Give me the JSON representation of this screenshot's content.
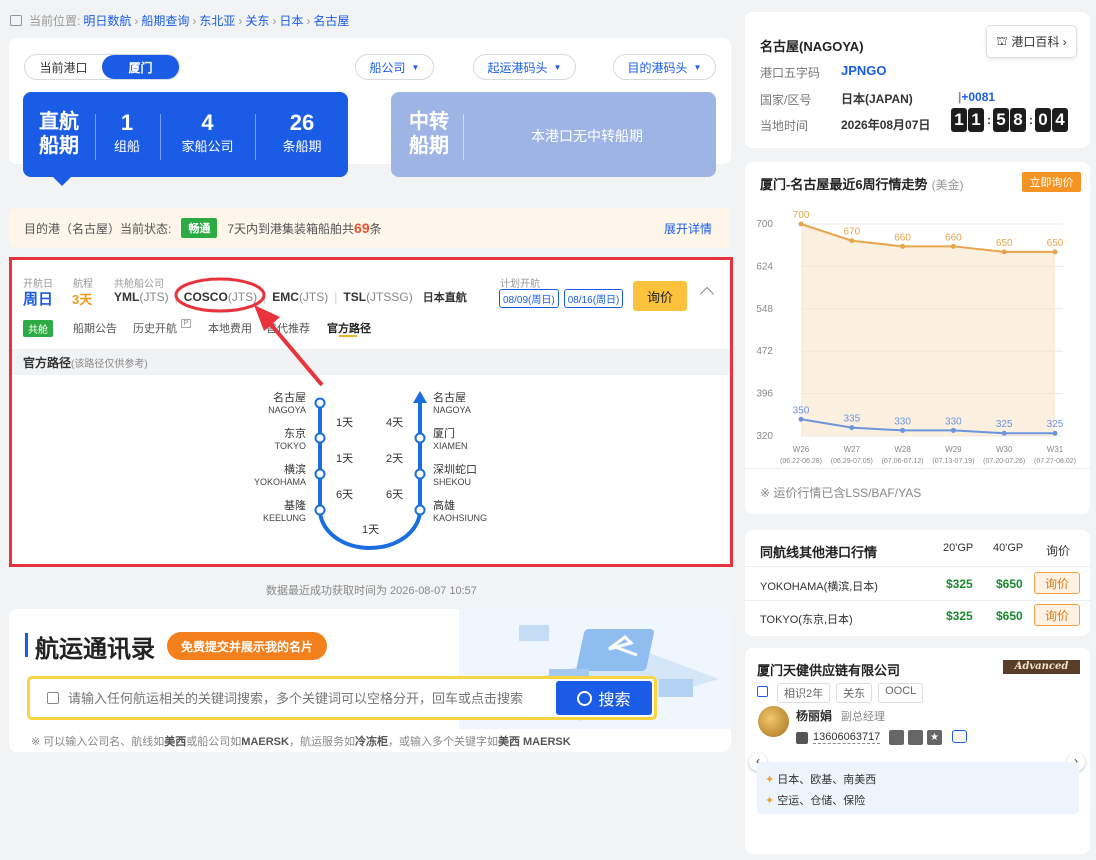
{
  "breadcrumb": {
    "label": "当前位置:",
    "items": [
      "明日数航",
      "船期查询",
      "东北亚",
      "关东",
      "日本",
      "名古屋"
    ]
  },
  "search_bar": {
    "segment": [
      "当前港口",
      "厦门"
    ],
    "filters": [
      "船公司",
      "起运港码头",
      "目的港码头"
    ]
  },
  "direct": {
    "title_1": "直航",
    "title_2": "船期",
    "stats": [
      {
        "value": "1",
        "label": "组船"
      },
      {
        "value": "4",
        "label": "家船公司"
      },
      {
        "value": "26",
        "label": "条船期"
      }
    ]
  },
  "transfer": {
    "title_1": "中转",
    "title_2": "船期",
    "message": "本港口无中转船期"
  },
  "status_bar": {
    "prefix": "目的港（名古屋）当前状态:",
    "badge": "畅通",
    "text_a": "7天内到港集装箱船舶共",
    "count": "69",
    "text_b": "条",
    "expand": "展开详情"
  },
  "schedule": {
    "labels": {
      "departure": "开航日",
      "transit": "航程",
      "carriers": "共舱船公司",
      "planned": "计划开航"
    },
    "departure_day": "周日",
    "transit_days": "3天",
    "carriers": [
      {
        "name": "YML",
        "code": "(JTS)"
      },
      {
        "name": "COSCO",
        "code": "(JTS)"
      },
      {
        "name": "EMC",
        "code": "(JTS)"
      },
      {
        "name": "TSL",
        "code": "(JTSSG)"
      }
    ],
    "route_type": "日本直航",
    "dates": [
      "08/09(周日)",
      "08/16(周日)"
    ],
    "inquiry": "询价",
    "shared_badge": "共舱",
    "tabs": [
      "船期公告",
      "历史开航",
      "本地费用",
      "替代推荐",
      "官方路径"
    ],
    "route_title": "官方路径",
    "route_note": "(该路径仅供参考)",
    "left_ports": [
      {
        "cn": "名古屋",
        "en": "NAGOYA"
      },
      {
        "cn": "东京",
        "en": "TOKYO"
      },
      {
        "cn": "横滨",
        "en": "YOKOHAMA"
      },
      {
        "cn": "基隆",
        "en": "KEELUNG"
      }
    ],
    "right_ports": [
      {
        "cn": "名古屋",
        "en": "NAGOYA"
      },
      {
        "cn": "厦门",
        "en": "XIAMEN"
      },
      {
        "cn": "深圳蛇口",
        "en": "SHEKOU"
      },
      {
        "cn": "高雄",
        "en": "KAOHSIUNG"
      }
    ],
    "left_days": [
      "1天",
      "1天",
      "6天"
    ],
    "right_days": [
      "4天",
      "2天",
      "6天"
    ],
    "bottom_days": "1天"
  },
  "data_time": "数据最近成功获取时间为 2026-08-07 10:57",
  "directory": {
    "title": "航运通讯录",
    "submit": "免费提交并展示我的名片",
    "placeholder": "请输入任何航运相关的关键词搜索，多个关键词可以空格分开，回车或点击搜索",
    "search_btn": "搜索",
    "tip_a": "※ 可以输入公司名、航线如",
    "tip_b": "美西",
    "tip_c": "或船公司如",
    "tip_d": "MAERSK",
    "tip_e": "，航运服务如",
    "tip_f": "冷冻柜",
    "tip_g": "，或输入多个关键字如",
    "tip_h": "美西 MAERSK"
  },
  "port_info": {
    "name": "名古屋(NAGOYA)",
    "wiki": "港口百科 ›",
    "code_label": "港口五字码",
    "code": "JPNGO",
    "country_label": "国家/区号",
    "country": "日本(JAPAN)",
    "dial": "+0081",
    "time_label": "当地时间",
    "date": "2026年08月07日",
    "clock": [
      "1",
      "1",
      "5",
      "8",
      "0",
      "4"
    ]
  },
  "trend": {
    "title": "厦门-名古屋最近6周行情走势",
    "unit": "(美金)",
    "inquire": "立即询价",
    "note": "※ 运价行情已含LSS/BAF/YAS"
  },
  "chart_data": {
    "type": "line",
    "categories": [
      "W26",
      "W27",
      "W28",
      "W29",
      "W30",
      "W31"
    ],
    "category_dates": [
      "(06.22-06.28)",
      "(06.29-07.05)",
      "(07.06-07.12)",
      "(07.13-07.19)",
      "(07.20-07.26)",
      "(07.27-08.02)"
    ],
    "series": [
      {
        "values": [
          700,
          670,
          660,
          660,
          650,
          650
        ],
        "color": "#e7a54c"
      },
      {
        "values": [
          350,
          335,
          330,
          330,
          325,
          325
        ],
        "color": "#6b95dd"
      }
    ],
    "yticks": [
      320,
      396,
      472,
      548,
      624,
      700
    ],
    "ylim": [
      320,
      700
    ],
    "grid": true
  },
  "same_route": {
    "title": "同航线其他港口行情",
    "col_20": "20'GP",
    "col_40": "40'GP",
    "col_inq": "询价",
    "rows": [
      {
        "port": "YOKOHAMA(横滨,日本)",
        "p20": "$325",
        "p40": "$650",
        "btn": "询价"
      },
      {
        "port": "TOKYO(东京,日本)",
        "p20": "$325",
        "p40": "$650",
        "btn": "询价"
      }
    ]
  },
  "company": {
    "name": "厦门天健供应链有限公司",
    "badge": "Advanced",
    "tags": [
      "相识2年",
      "关东",
      "OOCL"
    ],
    "person": "杨丽娟",
    "role": "副总经理",
    "phone": "13606063717",
    "services": [
      "日本、欧基、南美西",
      "空运、仓储、保险"
    ]
  },
  "colors": {
    "primary": "#1a5ce6",
    "accent": "#fcc23c",
    "alert": "#e8323c"
  }
}
